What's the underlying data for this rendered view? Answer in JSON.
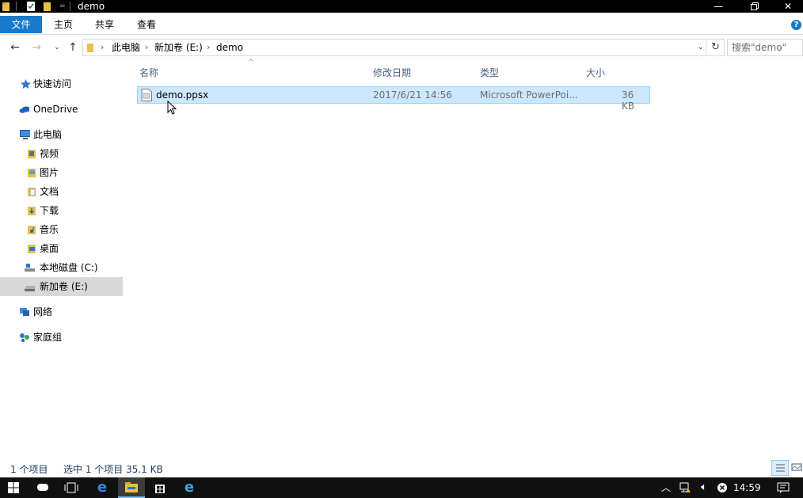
{
  "window": {
    "title": "demo"
  },
  "ribbon": {
    "tabs": [
      "文件",
      "主页",
      "共享",
      "查看"
    ]
  },
  "nav": {
    "breadcrumb": [
      "此电脑",
      "新加卷 (E:)",
      "demo"
    ],
    "search_placeholder": "搜索\"demo\""
  },
  "sidebar": {
    "items": [
      {
        "label": "快速访问"
      },
      {
        "label": "OneDrive"
      },
      {
        "label": "此电脑"
      },
      {
        "label": "视频"
      },
      {
        "label": "图片"
      },
      {
        "label": "文档"
      },
      {
        "label": "下载"
      },
      {
        "label": "音乐"
      },
      {
        "label": "桌面"
      },
      {
        "label": "本地磁盘 (C:)"
      },
      {
        "label": "新加卷 (E:)"
      },
      {
        "label": "网络"
      },
      {
        "label": "家庭组"
      }
    ]
  },
  "columns": {
    "name": "名称",
    "modified": "修改日期",
    "type": "类型",
    "size": "大小"
  },
  "files": [
    {
      "name": "demo.ppsx",
      "modified": "2017/6/21 14:56",
      "type": "Microsoft PowerPoi...",
      "size": "36 KB"
    }
  ],
  "status": {
    "count": "1 个项目",
    "selected": "选中 1 个项目  35.1 KB"
  },
  "taskbar": {
    "time": "14:59"
  },
  "colors": {
    "accent": "#1979ca",
    "selection": "#cce8ff",
    "selection_border": "#99d1ff"
  }
}
